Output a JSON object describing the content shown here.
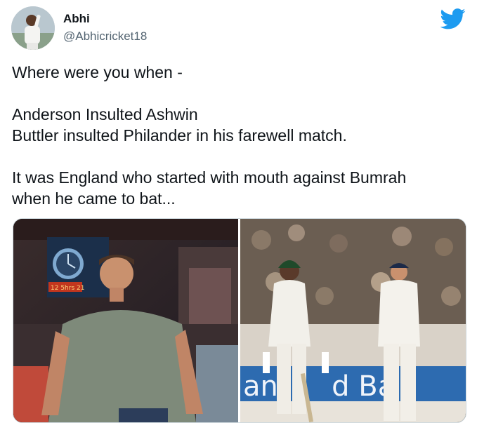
{
  "author": {
    "display_name": "Abhi",
    "handle": "@Abhicricket18",
    "avatar_icon": "profile-photo-cricketer"
  },
  "platform_icon": "twitter-bird-icon",
  "tweet": {
    "lines": [
      "Where were you when -",
      "",
      "Anderson Insulted Ashwin",
      "Buttler insulted Philander in his farewell match.",
      "",
      "It was England who started with mouth against Bumrah",
      "when he came to bat..."
    ]
  },
  "media": {
    "left_photo": {
      "subject": "player-in-grey-tshirt-stadium-screen",
      "scoreboard_text": "12 5hrs 21"
    },
    "right_photo": {
      "subject": "two-players-test-whites-on-field",
      "banner_text": "an      d Ba"
    }
  },
  "colors": {
    "twitter_blue": "#1d9bf0",
    "text_primary": "#0f1419",
    "text_secondary": "#536471"
  }
}
